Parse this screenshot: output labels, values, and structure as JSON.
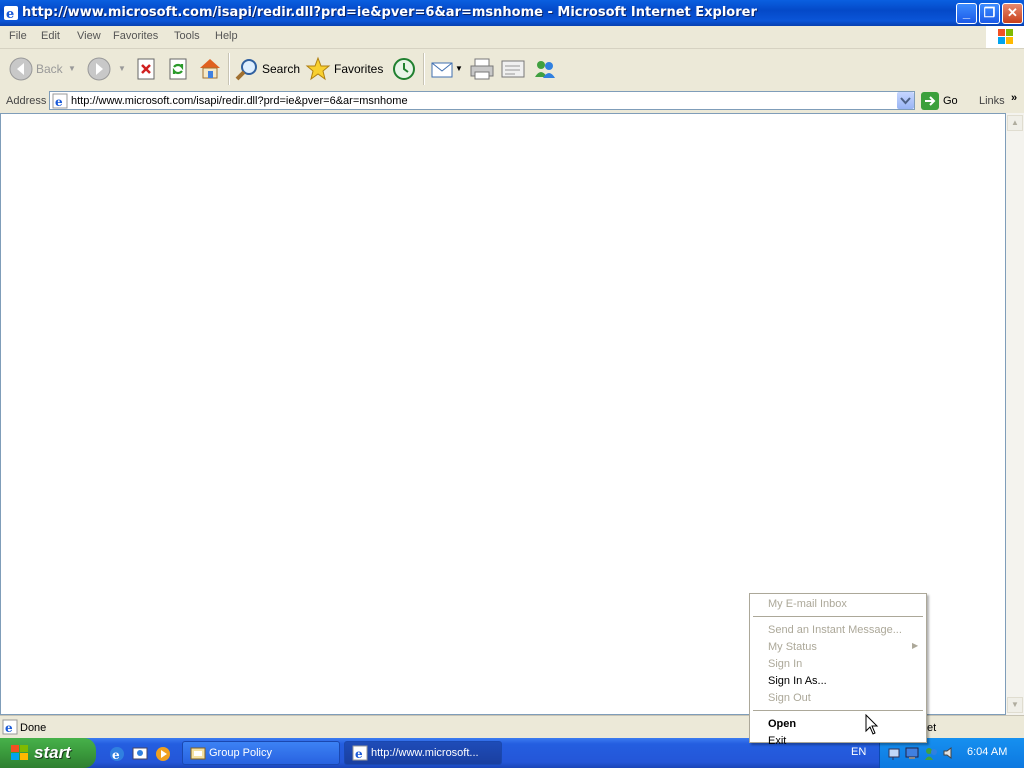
{
  "window": {
    "title": "http://www.microsoft.com/isapi/redir.dll?prd=ie&pver=6&ar=msnhome - Microsoft Internet Explorer",
    "controls": {
      "minimize": "_",
      "restore": "❐",
      "close": "✕"
    }
  },
  "menubar": {
    "items": [
      "File",
      "Edit",
      "View",
      "Favorites",
      "Tools",
      "Help"
    ]
  },
  "toolbar": {
    "back_label": "Back",
    "search_label": "Search",
    "favorites_label": "Favorites"
  },
  "addressbar": {
    "label": "Address",
    "url": "http://www.microsoft.com/isapi/redir.dll?prd=ie&pver=6&ar=msnhome",
    "go_label": "Go",
    "links_label": "Links"
  },
  "statusbar": {
    "text": "Done",
    "zone_partial": "et"
  },
  "context_menu": {
    "items": [
      {
        "label": "My E-mail Inbox",
        "enabled": false
      },
      {
        "label": "Send an Instant Message...",
        "enabled": false
      },
      {
        "label": "My Status",
        "enabled": false,
        "submenu": true
      },
      {
        "label": "Sign In",
        "enabled": false
      },
      {
        "label": "Sign In As...",
        "enabled": true
      },
      {
        "label": "Sign Out",
        "enabled": false
      },
      {
        "label": "Open",
        "enabled": true,
        "bold": true
      },
      {
        "label": "Exit",
        "enabled": true
      }
    ]
  },
  "taskbar": {
    "start_label": "start",
    "tasks": [
      {
        "label": "Group Policy"
      },
      {
        "label": "http://www.microsoft..."
      }
    ],
    "language": "EN",
    "clock": "6:04 AM"
  },
  "colors": {
    "title_blue": "#0a5fe0",
    "taskbar_blue": "#245ee0",
    "start_green": "#3a9a3c",
    "tray_blue": "#1690f0"
  }
}
